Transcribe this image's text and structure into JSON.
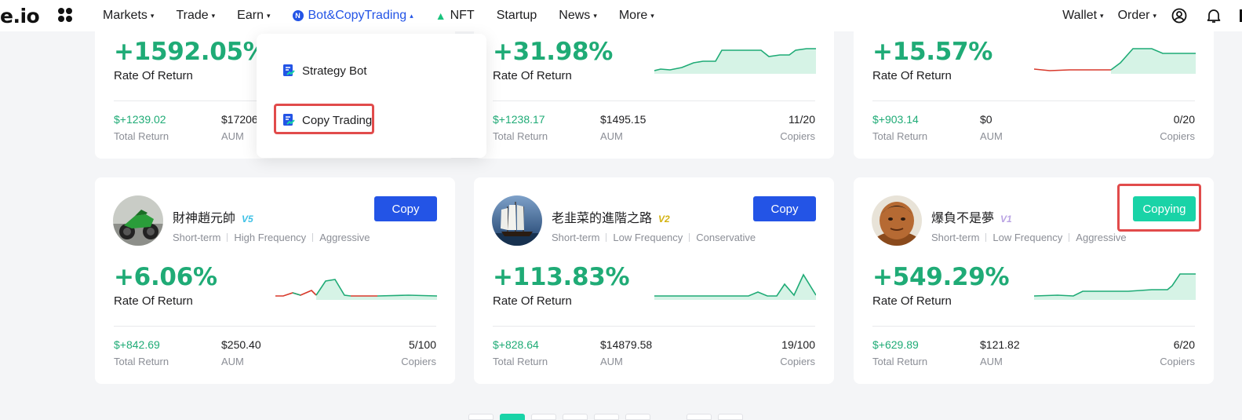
{
  "nav": {
    "logo": "e.io",
    "items": [
      {
        "label": "Markets",
        "caret": "▾"
      },
      {
        "label": "Trade",
        "caret": "▾"
      },
      {
        "label": "Earn",
        "caret": "▾"
      },
      {
        "label": "Bot&CopyTrading",
        "caret": "▴",
        "icon_text": "N"
      },
      {
        "label": "NFT"
      },
      {
        "label": "Startup"
      },
      {
        "label": "News",
        "caret": "▾"
      },
      {
        "label": "More",
        "caret": "▾"
      }
    ],
    "right": [
      {
        "label": "Wallet",
        "caret": "▾"
      },
      {
        "label": "Order",
        "caret": "▾"
      }
    ]
  },
  "dropdown": {
    "items": [
      {
        "label": "Strategy Bot"
      },
      {
        "label": "Copy Trading"
      }
    ]
  },
  "labels": {
    "rate_of_return": "Rate Of Return",
    "total_return": "Total Return",
    "aum": "AUM",
    "copiers": "Copiers"
  },
  "cards_top": [
    {
      "ror": "+1592.05%",
      "total_return": "$+1239.02",
      "aum": "$17206",
      "copiers": ""
    },
    {
      "ror": "+31.98%",
      "total_return": "$+1238.17",
      "aum": "$1495.15",
      "copiers": "11/20"
    },
    {
      "ror": "+15.57%",
      "total_return": "$+903.14",
      "aum": "$0",
      "copiers": "0/20"
    }
  ],
  "cards_bottom": [
    {
      "name": "財神趙元帥",
      "level": "V5",
      "level_color": "#3ec1e6",
      "tags": [
        "Short-term",
        "High Frequency",
        "Aggressive"
      ],
      "button": "Copy",
      "ror": "+6.06%",
      "total_return": "$+842.69",
      "aum": "$250.40",
      "copiers": "5/100"
    },
    {
      "name": "老韭菜的進階之路",
      "level": "V2",
      "level_color": "#d4b312",
      "tags": [
        "Short-term",
        "Low Frequency",
        "Conservative"
      ],
      "button": "Copy",
      "ror": "+113.83%",
      "total_return": "$+828.64",
      "aum": "$14879.58",
      "copiers": "19/100"
    },
    {
      "name": "爆負不是夢",
      "level": "V1",
      "level_color": "#b9a3e3",
      "tags": [
        "Short-term",
        "Low Frequency",
        "Aggressive"
      ],
      "button": "Copying",
      "ror": "+549.29%",
      "total_return": "$+629.89",
      "aum": "$121.82",
      "copiers": "6/20"
    }
  ],
  "colors": {
    "brand_blue": "#2354e6",
    "profit_green": "#1fab76",
    "copying_teal": "#19d3a7",
    "loss_red": "#d8392b",
    "highlight_red": "#e14b4b"
  }
}
